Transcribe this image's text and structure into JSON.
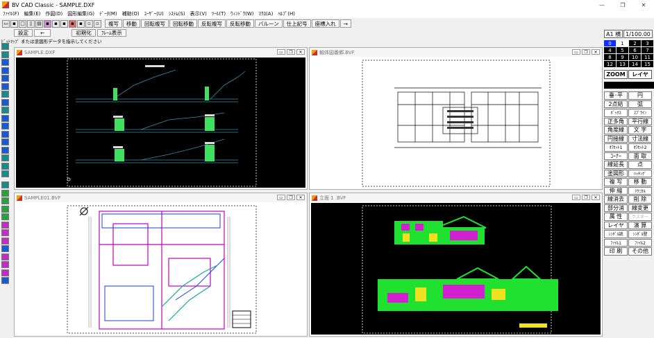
{
  "window": {
    "title": "BV CAD Classic - SAMPLE.DXF",
    "controls": [
      "—",
      "❐",
      "✕"
    ]
  },
  "menu": [
    "ﾌｧｲﾙ(F)",
    "編集(E)",
    "作図(D)",
    "図形編集(G)",
    "ﾃﾞｰﾀ(M)",
    "補助(O)",
    "ﾕｰｻﾞｰ(U)",
    "ｼｽﾃﾑ(S)",
    "表示(V)",
    "ﾂｰﾙ(T)",
    "ｳｨﾝﾄﾞｳ(W)",
    "ﾏｸﾛ(A)",
    "ﾍﾙﾌﾟ(H)"
  ],
  "toolbar": {
    "commands": [
      "複写",
      "移動",
      "回転複写",
      "回転移動",
      "反転複写",
      "反転移動",
      "バルーン",
      "仕上記号",
      "座標入れ",
      "→"
    ]
  },
  "toolbar2": {
    "settings": "設定",
    "back": "←",
    "init": "初期化",
    "frame": "ﾌﾚｰﾑ表示"
  },
  "status": "ﾋﾞｯﾄﾏｯﾌﾟ または塗図形データを指示してください",
  "windows": [
    {
      "title": "SAMPLE.DXF"
    },
    {
      "title": "軸体図番郷.BVF"
    },
    {
      "title": "SAMPLE01.BVF"
    },
    {
      "title": "立面 1 .BVF"
    }
  ],
  "right": {
    "paper": "A1 横",
    "scale": "1/100.00",
    "colors": [
      "0",
      "1",
      "2",
      "3",
      "4",
      "5",
      "6",
      "7",
      "8",
      "9",
      "10",
      "11",
      "12",
      "13",
      "14",
      "15"
    ],
    "zoom": "ZOOM",
    "layer": "レイヤ",
    "commands": [
      "垂･平",
      "円",
      "2点結",
      "弧",
      "ﾎﾞｯｸｽ",
      "ｽﾌﾟﾗｲﾝ",
      "正多角",
      "平行線",
      "角度線",
      "文 字",
      "円接線",
      "寸法線",
      "ｵﾌｾｯﾄ1",
      "ｵﾌｾｯﾄ2",
      "ｺｰﾅｰ",
      "面 取",
      "線延長",
      "点",
      "塗図形",
      "ﾊｯﾁﾝｸﾞ",
      "複 写",
      "移 動",
      "伸 縮",
      "ﾃｸﾆｶﾙ",
      "線消去",
      "削 除",
      "部分消",
      "線変更",
      "属 性",
      "ラスター",
      "レイヤ",
      "演 算",
      "ｼﾝﾎﾞﾙ読",
      "ｼﾝﾎﾞﾙ登",
      "ﾌｧｲﾙ1",
      "ﾌｧｲﾙ2",
      "印 刷",
      "その他"
    ]
  }
}
